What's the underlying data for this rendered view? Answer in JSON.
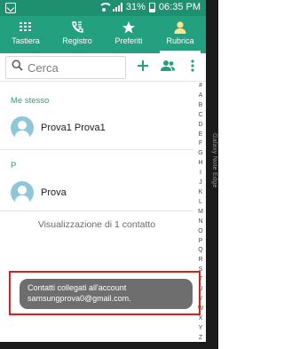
{
  "status_bar": {
    "battery": "31%",
    "time": "06:35 PM",
    "battery_level": 0.31
  },
  "tabs": [
    {
      "label": "Tastiera",
      "icon": "dialpad-icon",
      "active": false
    },
    {
      "label": "Registro",
      "icon": "call-log-icon",
      "active": false
    },
    {
      "label": "Preferiti",
      "icon": "star-icon",
      "active": false
    },
    {
      "label": "Rubrica",
      "icon": "person-icon",
      "active": true
    }
  ],
  "search": {
    "placeholder": "Cerca"
  },
  "actions": {
    "add_icon": "plus-icon",
    "groups_icon": "groups-icon",
    "more_icon": "more-vert-icon"
  },
  "sections": {
    "me": "Me stesso",
    "p": "P"
  },
  "contacts": {
    "me_name": "Prova1 Prova1",
    "p_name": "Prova"
  },
  "count_text": "Visualizzazione di 1 contatto",
  "alpha_index": [
    "#",
    "A",
    "B",
    "C",
    "D",
    "E",
    "F",
    "G",
    "H",
    "I",
    "J",
    "K",
    "L",
    "M",
    "N",
    "O",
    "P",
    "Q",
    "R",
    "S",
    "T",
    "U",
    "V",
    "W",
    "X",
    "Y",
    "Z"
  ],
  "toast": {
    "line1": "Contatti collegati all'account",
    "line2": "samsungprova0@gmail.com."
  },
  "device_edge_text": "Galaxy Note Edge",
  "colors": {
    "accent": "#23a07f",
    "status_bar": "#1e8f6f",
    "toast_bg": "#6e6e6e",
    "highlight": "#e01b1b",
    "avatar": "#8ec7da"
  }
}
